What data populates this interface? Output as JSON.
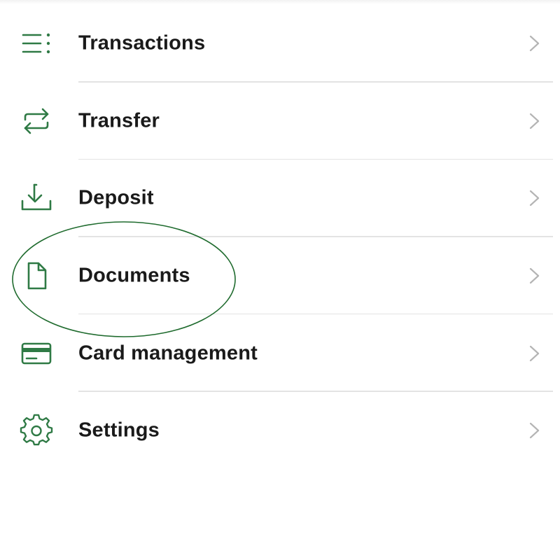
{
  "menu": {
    "items": [
      {
        "label": "Transactions",
        "icon": "list-icon"
      },
      {
        "label": "Transfer",
        "icon": "transfer-arrows-icon"
      },
      {
        "label": "Deposit",
        "icon": "download-tray-icon"
      },
      {
        "label": "Documents",
        "icon": "document-icon"
      },
      {
        "label": "Card management",
        "icon": "credit-card-icon"
      },
      {
        "label": "Settings",
        "icon": "gear-icon"
      }
    ]
  },
  "colors": {
    "icon_green": "#2f7a45",
    "text": "#1a1a1a",
    "chevron": "#b4b4b4",
    "divider": "#e3e3e3",
    "highlight_circle": "#1f6b2e"
  },
  "annotation": {
    "shape": "ellipse",
    "highlighted_item": "Documents"
  }
}
